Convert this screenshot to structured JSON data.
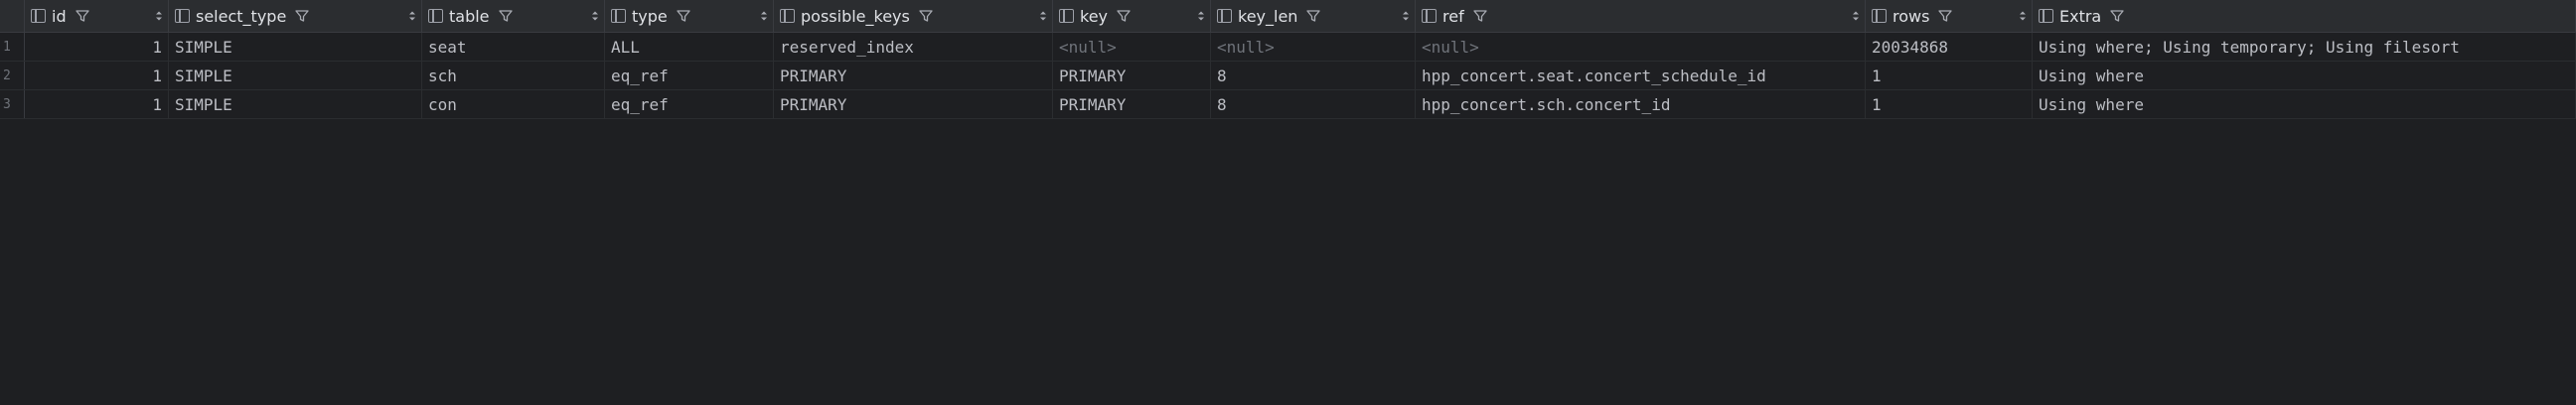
{
  "columns": [
    {
      "name": "id"
    },
    {
      "name": "select_type"
    },
    {
      "name": "table"
    },
    {
      "name": "type"
    },
    {
      "name": "possible_keys"
    },
    {
      "name": "key"
    },
    {
      "name": "key_len"
    },
    {
      "name": "ref"
    },
    {
      "name": "rows"
    },
    {
      "name": "Extra"
    }
  ],
  "rows": [
    {
      "num": "1",
      "id": "1",
      "select_type": "SIMPLE",
      "table": "seat",
      "type": "ALL",
      "possible_keys": "reserved_index",
      "key": "<null>",
      "key_len": "<null>",
      "ref": "<null>",
      "rows": "20034868",
      "extra": "Using where; Using temporary; Using filesort"
    },
    {
      "num": "2",
      "id": "1",
      "select_type": "SIMPLE",
      "table": "sch",
      "type": "eq_ref",
      "possible_keys": "PRIMARY",
      "key": "PRIMARY",
      "key_len": "8",
      "ref": "hpp_concert.seat.concert_schedule_id",
      "rows": "1",
      "extra": "Using where"
    },
    {
      "num": "3",
      "id": "1",
      "select_type": "SIMPLE",
      "table": "con",
      "type": "eq_ref",
      "possible_keys": "PRIMARY",
      "key": "PRIMARY",
      "key_len": "8",
      "ref": "hpp_concert.sch.concert_id",
      "rows": "1",
      "extra": "Using where"
    }
  ],
  "icons": {
    "column": "column-icon",
    "filter": "filter-icon",
    "sort": "sort-icon"
  },
  "colors": {
    "background": "#1e1f22",
    "header": "#2b2d30",
    "text": "#bcbec4",
    "null_text": "#6f737a"
  }
}
